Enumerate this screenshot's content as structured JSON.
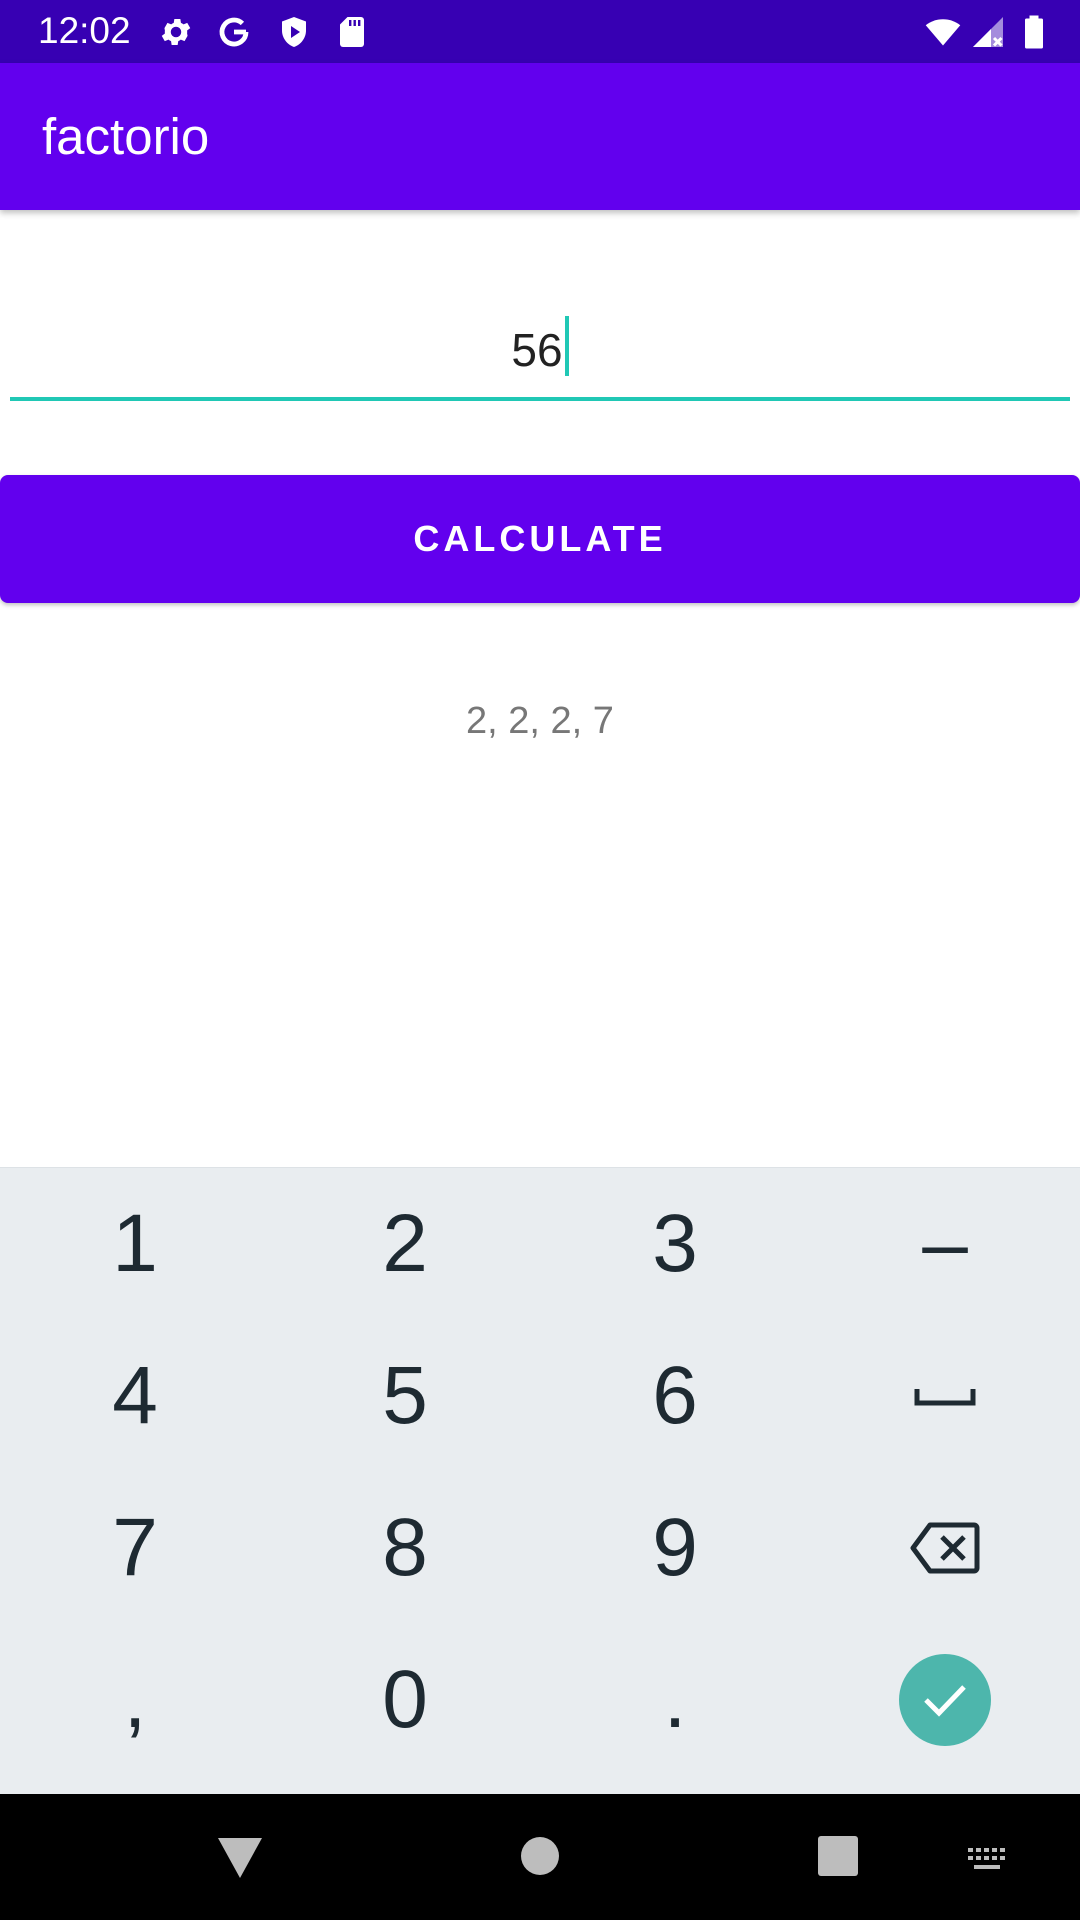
{
  "status_bar": {
    "time": "12:02",
    "icons": [
      "gear-icon",
      "google-icon",
      "shield-play-icon",
      "sd-card-icon",
      "wifi-icon",
      "signal-icon",
      "battery-icon"
    ]
  },
  "app_bar": {
    "title": "factorio"
  },
  "input": {
    "value": "56"
  },
  "button": {
    "label": "CALCULATE"
  },
  "result": {
    "text": "2, 2, 2, 7"
  },
  "keyboard": {
    "keys": [
      "1",
      "2",
      "3",
      "–",
      "4",
      "5",
      "6",
      "7",
      "8",
      "9",
      ",",
      "0",
      "."
    ],
    "special": [
      "space-key-icon",
      "backspace-icon",
      "done-check-icon"
    ]
  },
  "nav_bar": {
    "icons": [
      "back-icon",
      "home-icon",
      "recents-icon",
      "keyboard-switch-icon"
    ]
  },
  "colors": {
    "status_bar": "#3700b3",
    "primary": "#6200ee",
    "accent": "#20c8b5",
    "done_key": "#4db6ac"
  }
}
